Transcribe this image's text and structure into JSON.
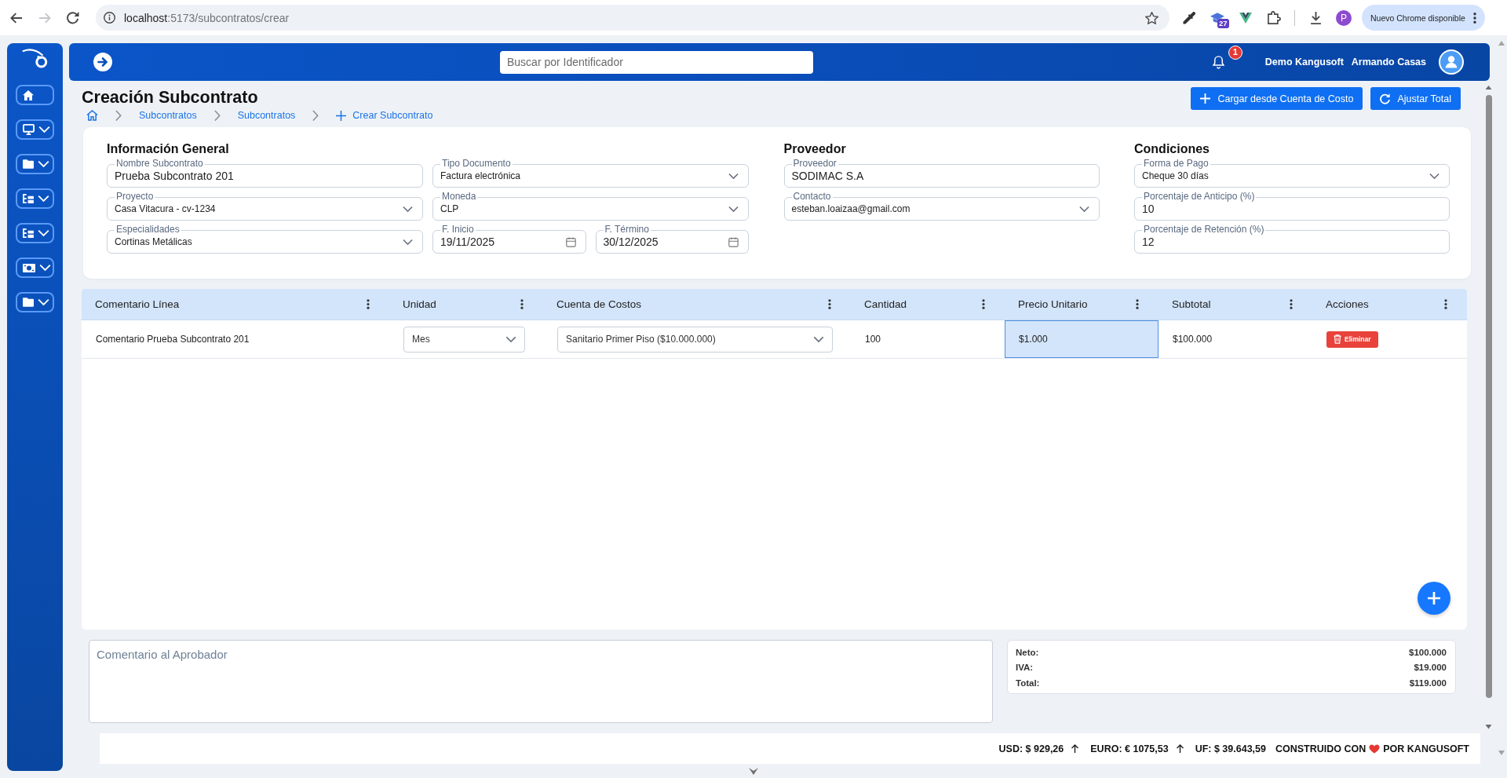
{
  "browser": {
    "nav": [
      {
        "kind": "back",
        "disabled": false
      },
      {
        "kind": "forward",
        "disabled": true
      },
      {
        "kind": "reload",
        "disabled": false
      }
    ],
    "address": {
      "host": "localhost",
      "path": ":5173/subcontratos/crear"
    },
    "extension_badge": "27",
    "profile_initial": "P",
    "update_button": "Nuevo Chrome disponible"
  },
  "sidebar": {
    "items": [
      {
        "kind": "home",
        "has_submenu": false
      },
      {
        "kind": "monitor",
        "has_submenu": true
      },
      {
        "kind": "folder",
        "has_submenu": true
      },
      {
        "kind": "tree",
        "has_submenu": true
      },
      {
        "kind": "tree",
        "has_submenu": true
      },
      {
        "kind": "money",
        "has_submenu": true
      },
      {
        "kind": "folder",
        "has_submenu": true
      }
    ]
  },
  "header": {
    "search": {
      "placeholder": "Buscar por Identificador"
    },
    "notifications": "1",
    "company": "Demo Kangusoft",
    "user": "Armando Casas"
  },
  "page": {
    "title": "Creación Subcontrato",
    "breadcrumbs": [
      {
        "kind": "home"
      },
      {
        "kind": "link",
        "label": "Subcontratos"
      },
      {
        "kind": "link",
        "label": "Subcontratos"
      },
      {
        "kind": "add",
        "label": "Crear Subcontrato"
      }
    ],
    "actions": [
      {
        "kind": "add",
        "label": "Cargar desde Cuenta de Costo"
      },
      {
        "kind": "refresh",
        "label": "Ajustar Total"
      }
    ]
  },
  "form": {
    "sections": [
      {
        "title": "Información General",
        "fields": [
          {
            "kind": "text",
            "label": "Nombre Subcontrato",
            "value": "Prueba Subcontrato 201"
          },
          {
            "kind": "select",
            "label": "Tipo Documento",
            "value": "Factura electrónica"
          },
          {
            "kind": "select",
            "label": "Proyecto",
            "value": "Casa Vitacura - cv-1234"
          },
          {
            "kind": "select",
            "label": "Moneda",
            "value": "CLP"
          },
          {
            "kind": "select",
            "label": "Especialidades",
            "value": "Cortinas Metálicas"
          },
          {
            "kind": "date",
            "label": "F. Inicio",
            "value": "19/11/2025"
          },
          {
            "kind": "date",
            "label": "F. Término",
            "value": "30/12/2025"
          }
        ]
      },
      {
        "title": "Proveedor",
        "fields": [
          {
            "kind": "text",
            "label": "Proveedor",
            "value": "SODIMAC S.A"
          },
          {
            "kind": "select",
            "label": "Contacto",
            "value": "esteban.loaizaa@gmail.com"
          }
        ]
      },
      {
        "title": "Condiciones",
        "fields": [
          {
            "kind": "select",
            "label": "Forma de Pago",
            "value": "Cheque 30 días"
          },
          {
            "kind": "text",
            "label": "Porcentaje de Anticipo (%)",
            "value": "10"
          },
          {
            "kind": "text",
            "label": "Porcentaje de Retención (%)",
            "value": "12"
          }
        ]
      }
    ]
  },
  "table": {
    "columns": [
      {
        "label": "Comentario Línea"
      },
      {
        "label": "Unidad"
      },
      {
        "label": "Cuenta de Costos"
      },
      {
        "label": "Cantidad"
      },
      {
        "label": "Precio Unitario"
      },
      {
        "label": "Subtotal"
      },
      {
        "label": "Acciones"
      }
    ],
    "rows": [
      {
        "cells": [
          {
            "kind": "text",
            "value": "Comentario Prueba Subcontrato 201",
            "selected": false
          },
          {
            "kind": "select",
            "value": "Mes",
            "selected": false
          },
          {
            "kind": "select",
            "value": "Sanitario Primer Piso ($10.000.000)",
            "selected": false
          },
          {
            "kind": "text",
            "value": "100",
            "selected": false
          },
          {
            "kind": "text",
            "value": "$1.000",
            "selected": true
          },
          {
            "kind": "text",
            "value": "$100.000",
            "selected": false
          },
          {
            "kind": "action",
            "value": "Eliminar",
            "selected": false
          }
        ]
      }
    ]
  },
  "comment": {
    "placeholder": "Comentario al Aprobador"
  },
  "totals": [
    {
      "label": "Neto:",
      "value": "$100.000"
    },
    {
      "label": "IVA:",
      "value": "$19.000"
    },
    {
      "label": "Total:",
      "value": "$119.000"
    }
  ],
  "footer": {
    "rates": [
      {
        "label": "USD: $ 929,26",
        "rising": true
      },
      {
        "label": "EURO: € 1075,53",
        "rising": true
      },
      {
        "label": "UF: $ 39.643,59",
        "rising": false
      }
    ],
    "credit": {
      "before": "CONSTRUIDO CON",
      "after": "POR KANGUSOFT"
    }
  }
}
